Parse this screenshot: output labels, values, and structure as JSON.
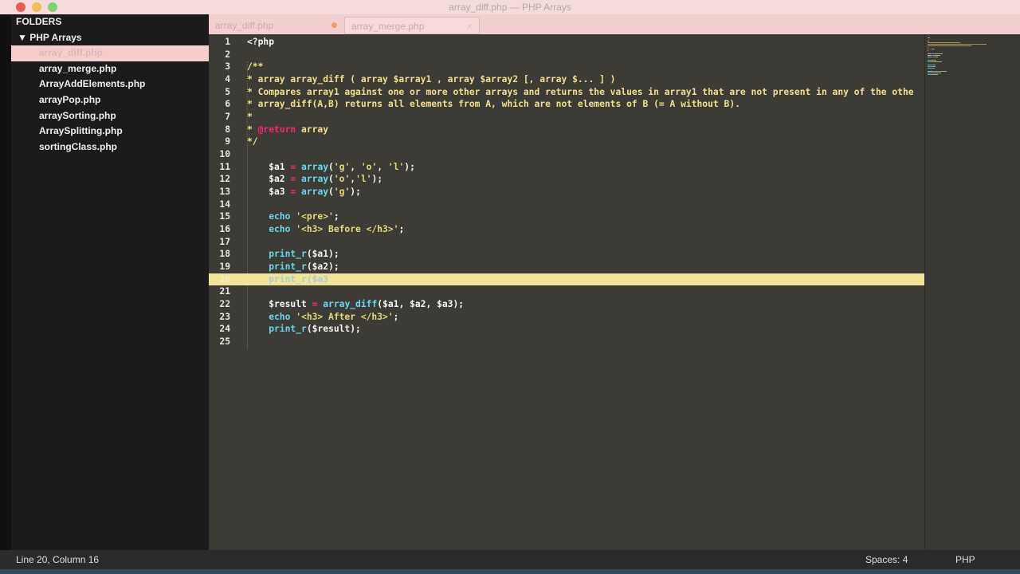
{
  "window": {
    "title": "array_diff.php — PHP Arrays"
  },
  "sidebar": {
    "header": "FOLDERS",
    "folder": "▼ PHP Arrays",
    "files": [
      "array_diff.php",
      "array_merge.php",
      "ArrayAddElements.php",
      "arrayPop.php",
      "arraySorting.php",
      "ArraySplitting.php",
      "sortingClass.php"
    ],
    "active_index": 0
  },
  "tabs": [
    {
      "label": "array_diff.php",
      "active": true
    },
    {
      "label": "array_merge.php",
      "active": false,
      "close": "×"
    }
  ],
  "colors": {
    "keyword": "#f92672",
    "function": "#66d9ef",
    "string": "#e6db74",
    "highlight": "#f2e59b"
  },
  "editor": {
    "highlighted_line": 20,
    "lines": [
      [
        [
          "<?php",
          "plain"
        ]
      ],
      [],
      [
        [
          "/**",
          "comment"
        ]
      ],
      [
        [
          "* array array_diff ( array $array1 , array $array2 [, array $... ] )",
          "comment"
        ]
      ],
      [
        [
          "* Compares array1 against one or more other arrays and returns the values in array1 that are not present in any of the othe",
          "comment"
        ]
      ],
      [
        [
          "* array_diff(A,B) returns all elements from A, which are not elements of B (= A without B).",
          "comment"
        ]
      ],
      [
        [
          "*",
          "comment"
        ]
      ],
      [
        [
          "* ",
          "comment"
        ],
        [
          "@return",
          "tag"
        ],
        [
          " array",
          "comment"
        ]
      ],
      [
        [
          "*/",
          "comment"
        ]
      ],
      [],
      [
        [
          "    $a1 ",
          "var"
        ],
        [
          "=",
          "op"
        ],
        [
          " array",
          "fn"
        ],
        [
          "(",
          "punct"
        ],
        [
          "'g'",
          "str"
        ],
        [
          ", ",
          "punct"
        ],
        [
          "'o'",
          "str"
        ],
        [
          ", ",
          "punct"
        ],
        [
          "'l'",
          "str"
        ],
        [
          ");",
          "punct"
        ]
      ],
      [
        [
          "    $a2 ",
          "var"
        ],
        [
          "=",
          "op"
        ],
        [
          " array",
          "fn"
        ],
        [
          "(",
          "punct"
        ],
        [
          "'o'",
          "str"
        ],
        [
          ",",
          "punct"
        ],
        [
          "'l'",
          "str"
        ],
        [
          ");",
          "punct"
        ]
      ],
      [
        [
          "    $a3 ",
          "var"
        ],
        [
          "=",
          "op"
        ],
        [
          " array",
          "fn"
        ],
        [
          "(",
          "punct"
        ],
        [
          "'g'",
          "str"
        ],
        [
          ");",
          "punct"
        ]
      ],
      [],
      [
        [
          "    echo ",
          "fn"
        ],
        [
          "'<pre>'",
          "str"
        ],
        [
          ";",
          "punct"
        ]
      ],
      [
        [
          "    echo ",
          "fn"
        ],
        [
          "'<h3> Before </h3>'",
          "str"
        ],
        [
          ";",
          "punct"
        ]
      ],
      [],
      [
        [
          "    print_r",
          "fn"
        ],
        [
          "($a1);",
          "punct"
        ]
      ],
      [
        [
          "    print_r",
          "fn"
        ],
        [
          "($a2);",
          "punct"
        ]
      ],
      [
        [
          "    print_r",
          "fn"
        ],
        [
          "($a3",
          "punct"
        ]
      ],
      [],
      [
        [
          "    $result ",
          "var"
        ],
        [
          "=",
          "op"
        ],
        [
          " array_diff",
          "fn"
        ],
        [
          "($a1, $a2, $a3);",
          "punct"
        ]
      ],
      [
        [
          "    echo ",
          "fn"
        ],
        [
          "'<h3> After </h3>'",
          "str"
        ],
        [
          ";",
          "punct"
        ]
      ],
      [
        [
          "    print_r",
          "fn"
        ],
        [
          "($result);",
          "punct"
        ]
      ],
      []
    ]
  },
  "statusbar": {
    "position": "Line 20, Column 16",
    "indent": "Spaces: 4",
    "syntax": "PHP"
  }
}
